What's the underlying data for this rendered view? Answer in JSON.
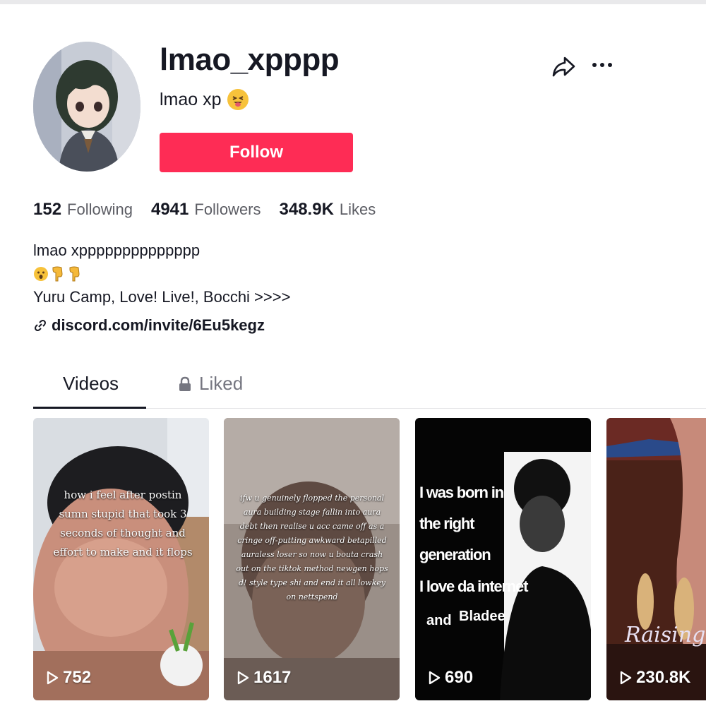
{
  "profile": {
    "username": "lmao_xpppp",
    "nickname": "lmao xp",
    "follow_label": "Follow"
  },
  "stats": [
    {
      "value": "152",
      "label": "Following"
    },
    {
      "value": "4941",
      "label": "Followers"
    },
    {
      "value": "348.9K",
      "label": "Likes"
    }
  ],
  "bio": {
    "line1": "lmao xpppppppppppppp",
    "line3": "Yuru Camp, Love! Live!, Bocchi >>>>",
    "link": "discord.com/invite/6Eu5kegz"
  },
  "tabs": {
    "videos": "Videos",
    "liked": "Liked"
  },
  "videos": [
    {
      "views": "752",
      "caption": "how i feel after postin sumn stupid that took 3 seconds of thought and effort to make and it flops"
    },
    {
      "views": "1617",
      "caption": "ifw u genuinely flopped the personal aura building stage fallin into aura debt then realise u acc came off as a cringe off-putting awkward betapilled auraless loser so now u bouta crash out on the tiktok method newgen hops d! style type shi and end it all lowkey on nettspend"
    },
    {
      "views": "690",
      "caption_a": "I was born in the right generation",
      "caption_b": "I love da internet",
      "caption_c": "and",
      "caption_d": "Bladee"
    },
    {
      "views": "230.8K",
      "caption": "Raising p"
    }
  ],
  "colors": {
    "accent": "#fe2c55",
    "text": "#161823",
    "muted": "#757680"
  }
}
